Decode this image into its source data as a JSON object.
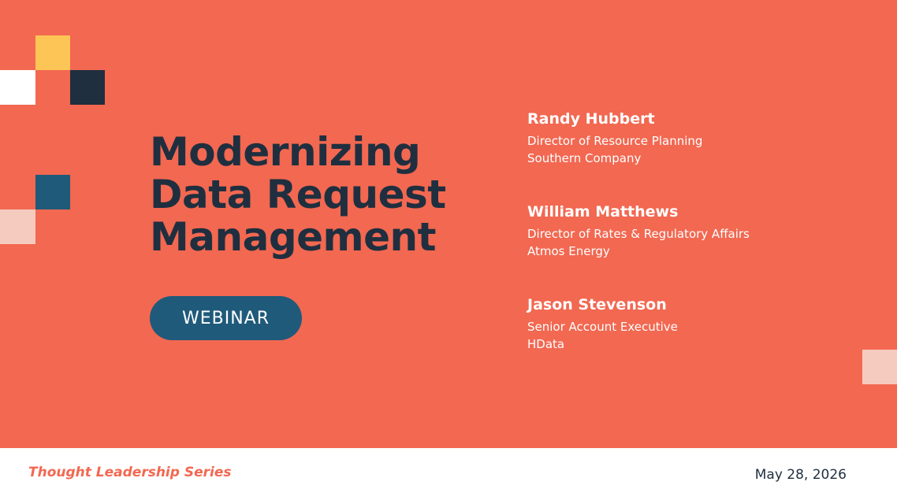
{
  "title_lines": [
    "Modernizing",
    "Data Request",
    "Management"
  ],
  "badge_label": "WEBINAR",
  "speakers": [
    {
      "name": "Randy Hubbert",
      "role": "Director of Resource Planning",
      "org": "Southern Company"
    },
    {
      "name": "William Matthews",
      "role": "Director of Rates & Regulatory Affairs",
      "org": "Atmos Energy"
    },
    {
      "name": "Jason Stevenson",
      "role": "Senior Account Executive",
      "org": "HData"
    }
  ],
  "footer": {
    "series": "Thought Leadership Series",
    "date": "May 28, 2026"
  },
  "colors": {
    "background": "#f26851",
    "navy": "#1f2f3f",
    "teal": "#1f5a7a",
    "yellow": "#fcc556",
    "pale": "#f6cbbf",
    "white": "#ffffff"
  }
}
